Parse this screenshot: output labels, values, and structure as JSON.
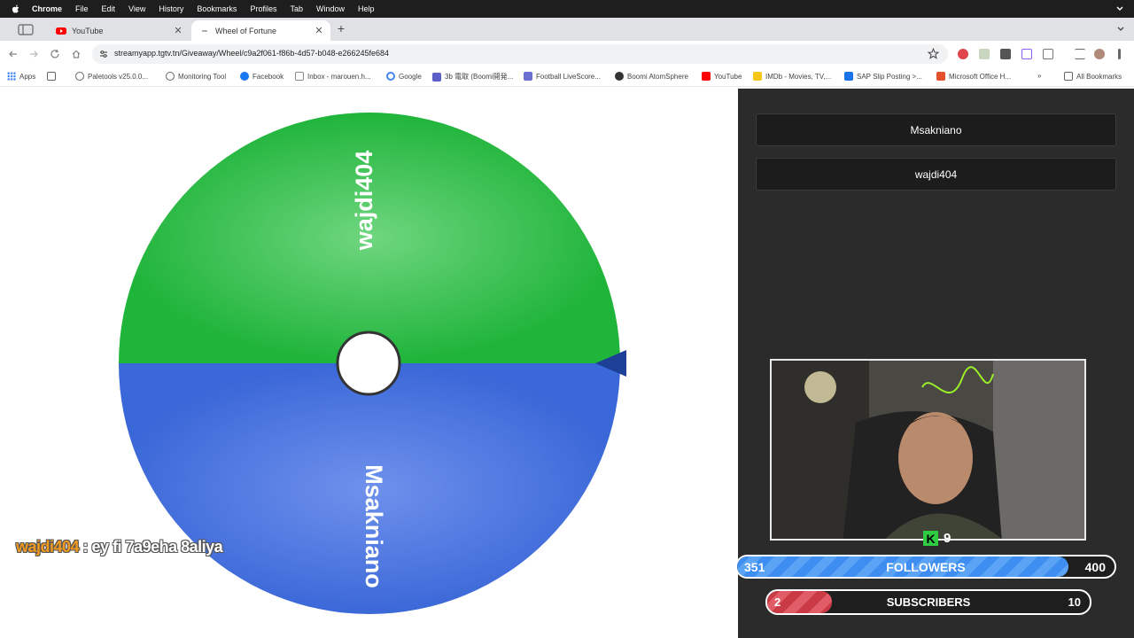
{
  "menubar": {
    "app": "Chrome",
    "items": [
      "File",
      "Edit",
      "View",
      "History",
      "Bookmarks",
      "Profiles",
      "Tab",
      "Window",
      "Help"
    ]
  },
  "tabs": [
    {
      "title": "YouTube",
      "icon": "youtube-icon"
    },
    {
      "title": "Wheel of Fortune",
      "icon": "loading-icon"
    }
  ],
  "toolbar": {
    "url": "streamyapp.tgtv.tn/Giveaway/Wheel/c9a2f061-f86b-4d57-b048-e266245fe684"
  },
  "bookmarks": {
    "items": [
      {
        "label": "Apps"
      },
      {
        "label": "Paletools v25.0.0..."
      },
      {
        "label": "Monitoring Tool"
      },
      {
        "label": "Facebook"
      },
      {
        "label": "Inbox - marouen.h..."
      },
      {
        "label": "Google"
      },
      {
        "label": "3b 電取 (Boomi開発..."
      },
      {
        "label": "Football LiveScore..."
      },
      {
        "label": "Boomi AtomSphere"
      },
      {
        "label": "YouTube"
      },
      {
        "label": "IMDb - Movies, TV,..."
      },
      {
        "label": "SAP Slip Posting >..."
      },
      {
        "label": "Microsoft Office H..."
      }
    ],
    "all_label": "All Bookmarks"
  },
  "wheel": {
    "segments": [
      {
        "label": "wajdi404",
        "color": "#1fb43a"
      },
      {
        "label": "Msakniano",
        "color": "#3b68d8"
      }
    ],
    "pointer_color": "#1d3f96"
  },
  "chat": {
    "user": "wajdi404",
    "message": " : ey fi 7a9eha 8aliya"
  },
  "entries": [
    "Msakniano",
    "wajdi404"
  ],
  "stream": {
    "kick_viewers": "9",
    "followers": {
      "current": "351",
      "label": "FOLLOWERS",
      "goal": "400",
      "progress": 0.8775
    },
    "subscribers": {
      "current": "2",
      "label": "SUBSCRIBERS",
      "goal": "10",
      "progress": 0.2
    }
  }
}
